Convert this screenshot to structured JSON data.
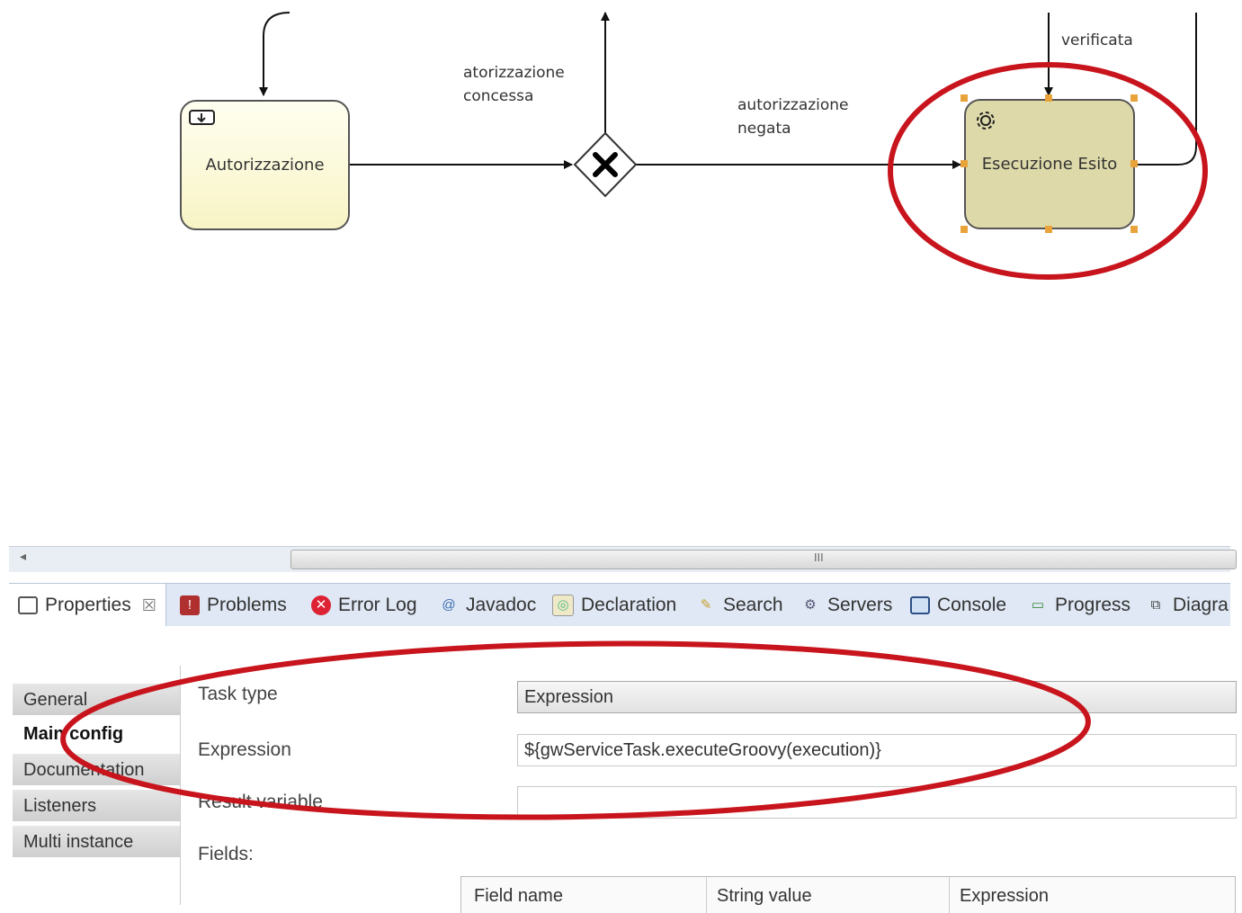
{
  "diagram": {
    "tasks": {
      "autorizzazione": "Autorizzazione",
      "esecuzione": "Esecuzione Esito"
    },
    "flows": {
      "concessa": "atorizzazione\nconcessa",
      "negata": "autorizzazione\nnegata",
      "verificata": "verificata"
    },
    "gateway_icon": "exclusive-gateway-x-icon",
    "user_task_icon": "user-task-icon",
    "service_task_icon": "gear-icon"
  },
  "scrollbar": {
    "left_arrow": "◂",
    "grip": "III"
  },
  "tabs": [
    {
      "label": "Properties",
      "close": "☒",
      "icon": "properties-icon"
    },
    {
      "label": "Problems",
      "icon": "problems-icon"
    },
    {
      "label": "Error Log",
      "icon": "error-log-icon"
    },
    {
      "label": "Javadoc",
      "icon": "at-icon"
    },
    {
      "label": "Declaration",
      "icon": "declaration-icon"
    },
    {
      "label": "Search",
      "icon": "search-icon"
    },
    {
      "label": "Servers",
      "icon": "servers-icon"
    },
    {
      "label": "Console",
      "icon": "console-icon"
    },
    {
      "label": "Progress",
      "icon": "progress-icon"
    },
    {
      "label": "Diagra",
      "icon": "diagram-icon"
    }
  ],
  "sidebar": {
    "items": [
      "General",
      "Main config",
      "Documentation",
      "Listeners",
      "Multi instance"
    ],
    "active": "Main config"
  },
  "form": {
    "task_type_label": "Task type",
    "task_type_value": "Expression",
    "expression_label": "Expression",
    "expression_value": "${gwServiceTask.executeGroovy(execution)}",
    "result_variable_label": "Result variable",
    "result_variable_value": "",
    "fields_label": "Fields:"
  },
  "fields_table": {
    "columns": [
      "Field name",
      "String value",
      "Expression"
    ]
  },
  "colors": {
    "annotation_red": "#c8141c",
    "selection_handle": "#e8a33a",
    "tab_bar": "#dfe8f4"
  }
}
